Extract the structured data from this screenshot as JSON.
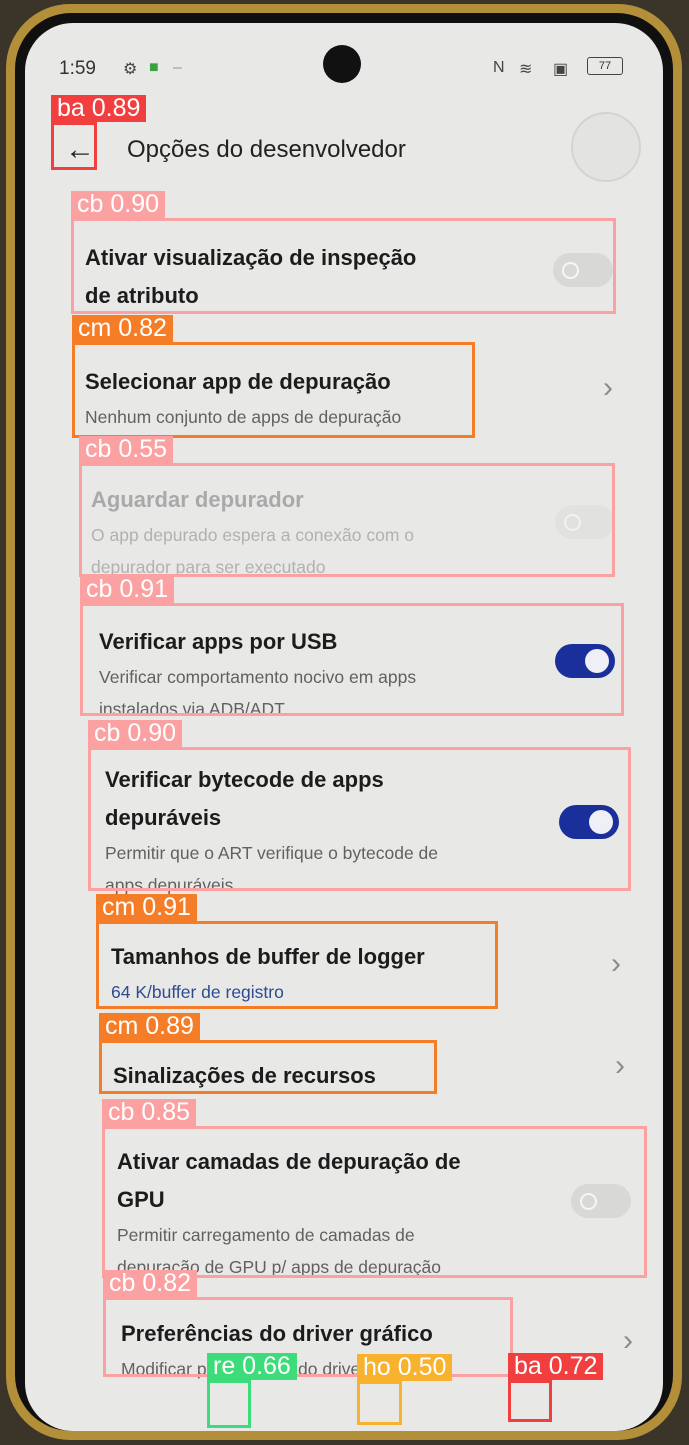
{
  "status_bar": {
    "time": "1:59",
    "battery": "77"
  },
  "header": {
    "title": "Opções do desenvolvedor"
  },
  "settings": [
    {
      "title": "Ativar visualização de inspeção de atributo",
      "title_l1": "Ativar visualização de inspeção",
      "title_l2": "de atributo",
      "toggle": "off"
    },
    {
      "title": "Selecionar app de depuração",
      "subtitle": "Nenhum conjunto de apps de depuração"
    },
    {
      "title": "Aguardar depurador",
      "subtitle_l1": "O app depurado espera a conexão com o",
      "subtitle_l2": "depurador para ser executado",
      "toggle": "disabled"
    },
    {
      "title": "Verificar apps por USB",
      "subtitle_l1": "Verificar comportamento nocivo em apps",
      "subtitle_l2": "instalados via ADB/ADT",
      "toggle": "on"
    },
    {
      "title_l1": "Verificar bytecode de apps",
      "title_l2": "depuráveis",
      "subtitle_l1": "Permitir que o ART verifique o bytecode de",
      "subtitle_l2": "apps depuráveis",
      "toggle": "on"
    },
    {
      "title": "Tamanhos de buffer de logger",
      "subtitle": "64 K/buffer de registro"
    },
    {
      "title": "Sinalizações de recursos"
    },
    {
      "title_l1": "Ativar camadas de depuração de",
      "title_l2": "GPU",
      "subtitle_l1": "Permitir carregamento de camadas de",
      "subtitle_l2": "depuração de GPU p/ apps de depuração",
      "toggle": "off"
    },
    {
      "title": "Preferências do driver gráfico",
      "subtitle": "Modificar preferências do driver gráfico"
    }
  ],
  "detections": [
    {
      "label": "ba 0.89"
    },
    {
      "label": "cb 0.90"
    },
    {
      "label": "cm 0.82"
    },
    {
      "label": "cb 0.55"
    },
    {
      "label": "cb 0.91"
    },
    {
      "label": "cb 0.90"
    },
    {
      "label": "cm 0.91"
    },
    {
      "label": "cm 0.89"
    },
    {
      "label": "cb 0.85"
    },
    {
      "label": "cb 0.82"
    },
    {
      "label": "re 0.66"
    },
    {
      "label": "ho 0.50"
    },
    {
      "label": "ba 0.72"
    }
  ],
  "colors": {
    "toggle_on": "#1a2f9a",
    "cb_box": "#fba1a1",
    "cm_box": "#f67d27",
    "ba_box": "#f13f3f",
    "re_box": "#3ddc7a",
    "ho_box": "#f9b22e"
  }
}
